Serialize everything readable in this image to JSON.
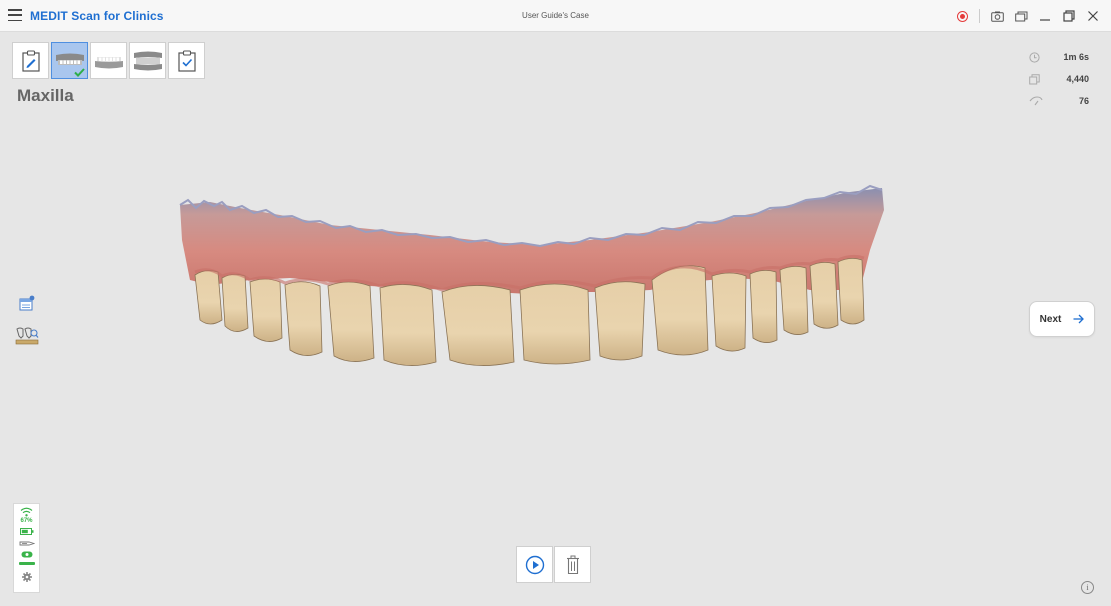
{
  "app": {
    "title": "MEDIT Scan for Clinics",
    "case_title": "User Guide's Case"
  },
  "titlebar_icons": [
    "menu-icon",
    "record-icon",
    "capture-icon",
    "window-icon",
    "minimize-icon",
    "maximize-icon",
    "close-icon"
  ],
  "steps": [
    {
      "name": "step-info",
      "icon": "clipboard-pencil-icon",
      "active": false
    },
    {
      "name": "step-maxilla",
      "icon": "maxilla-icon",
      "active": true,
      "completed": true
    },
    {
      "name": "step-mandible",
      "icon": "mandible-icon",
      "active": false
    },
    {
      "name": "step-occlusion",
      "icon": "occlusion-icon",
      "active": false
    },
    {
      "name": "step-review",
      "icon": "clipboard-check-icon",
      "active": false
    }
  ],
  "current_step_title": "Maxilla",
  "stats": {
    "time": "1m 6s",
    "frames": "4,440",
    "rate": "76"
  },
  "status": {
    "wifi_percent": "67%"
  },
  "next_button": {
    "label": "Next"
  },
  "colors": {
    "accent": "#1f6fd1",
    "active_step": "#a9c6ee",
    "record": "#e53b3b",
    "status_green": "#3ab34a",
    "background": "#e6e6e6"
  }
}
